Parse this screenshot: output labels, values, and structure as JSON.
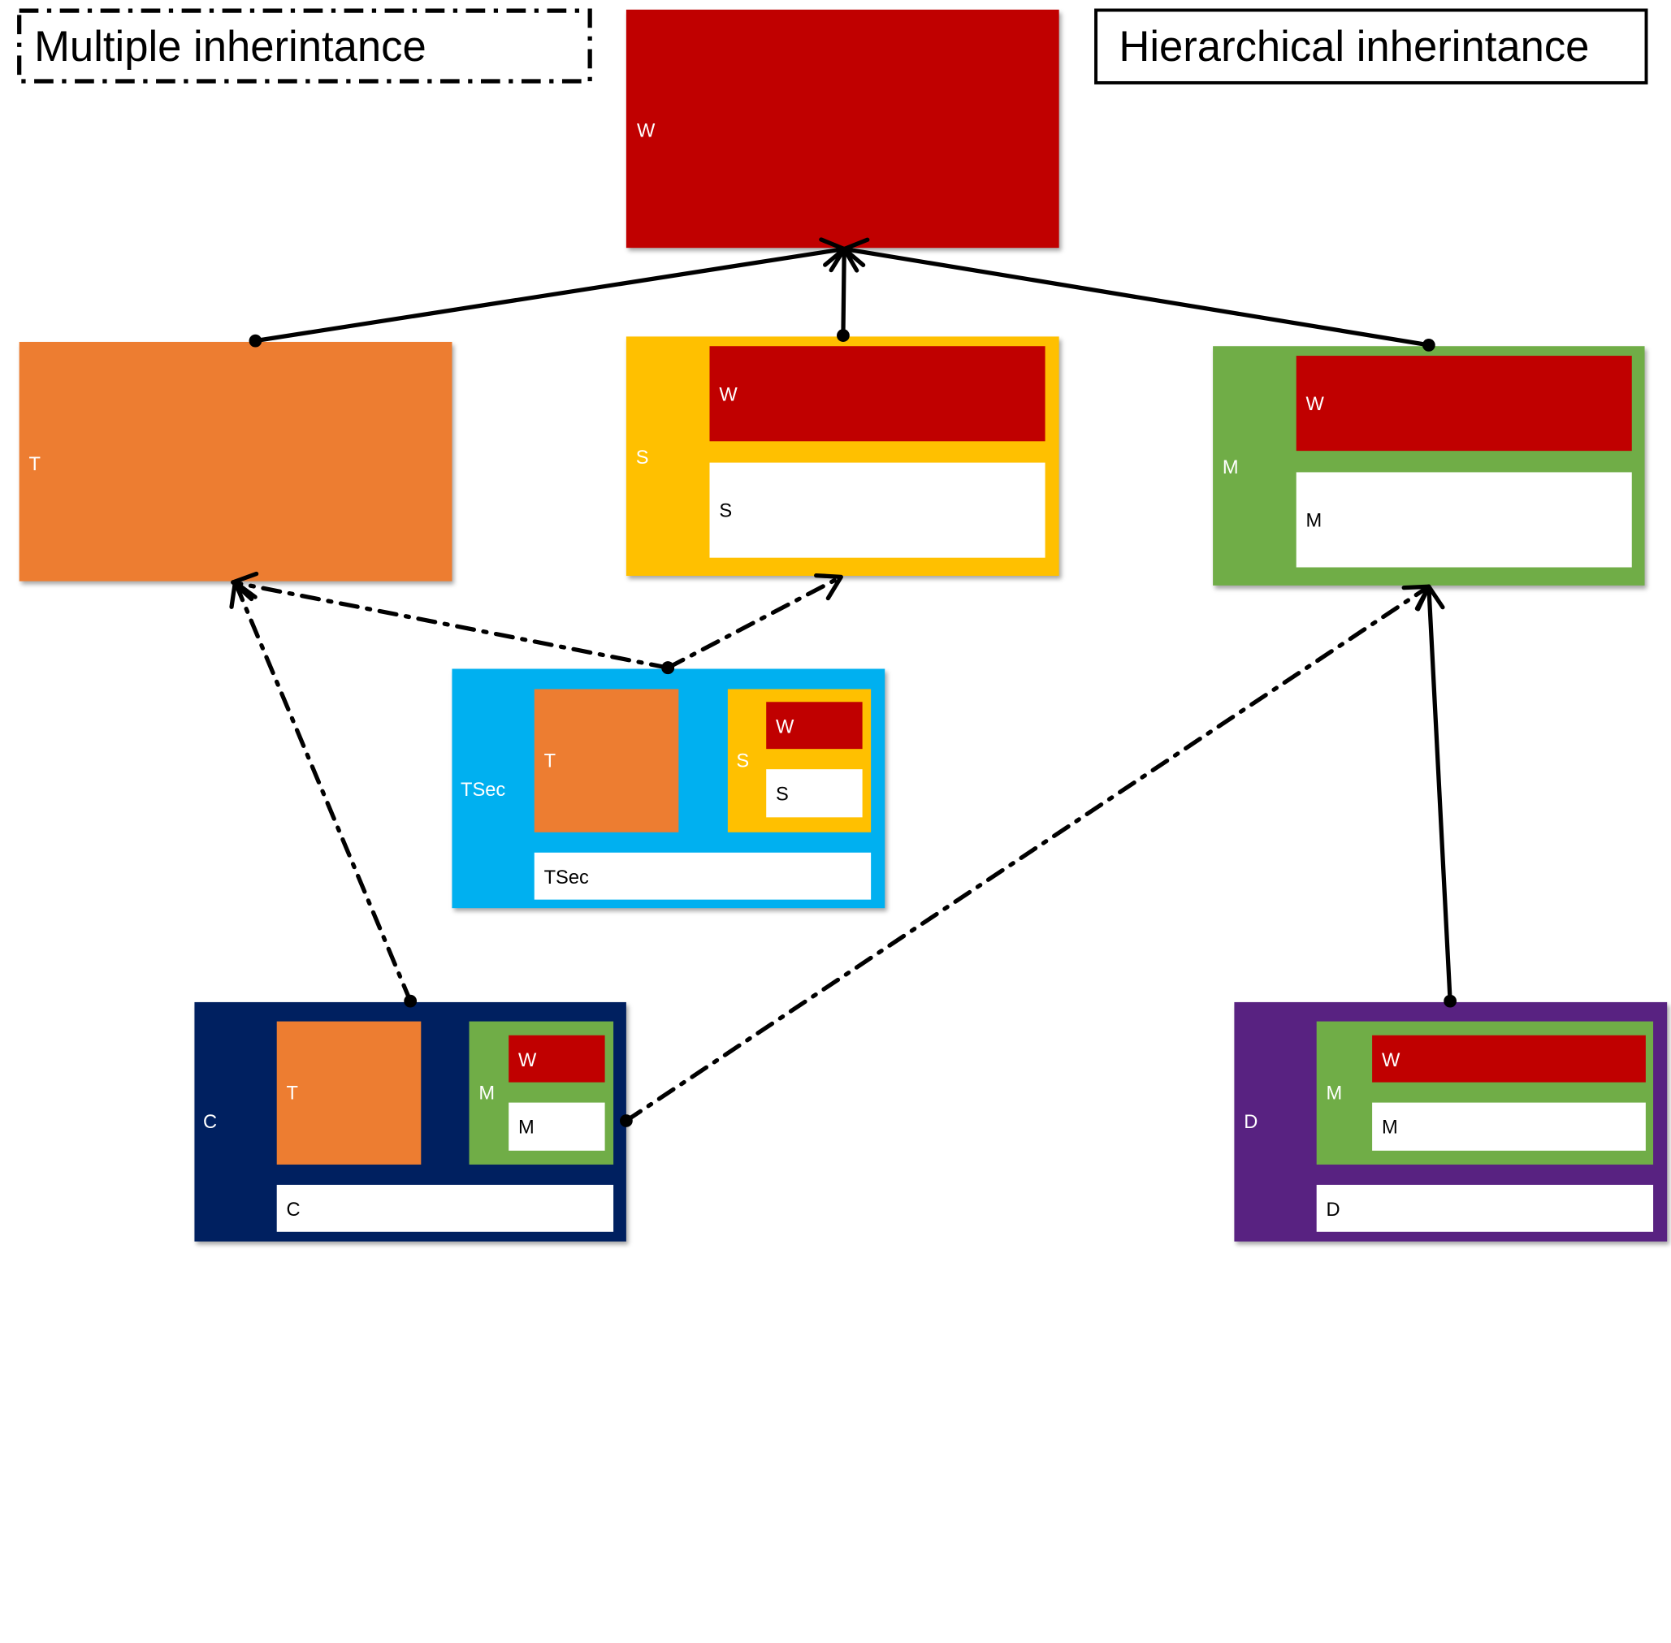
{
  "legend": {
    "multiple": "Multiple inherintance",
    "hierarchical": "Hierarchical inherintance"
  },
  "colors": {
    "W": "#c00000",
    "T": "#ed7d31",
    "S": "#ffc000",
    "M": "#70ad47",
    "TSec": "#00b0f0",
    "C": "#002060",
    "D": "#582281",
    "slot": "#ffffff",
    "line": "#000000"
  },
  "boxes": {
    "W": {
      "label": "W"
    },
    "T": {
      "label": "T"
    },
    "S": {
      "label": "S",
      "inner_w": "W",
      "inner_s": "S"
    },
    "M": {
      "label": "M",
      "inner_w": "W",
      "inner_m": "M"
    },
    "TSec": {
      "label": "TSec",
      "inner_t": "T",
      "inner_s_outer": "S",
      "inner_s_w": "W",
      "inner_s_s": "S",
      "inner_tsec": "TSec"
    },
    "C": {
      "label": "C",
      "inner_t": "T",
      "inner_m_outer": "M",
      "inner_m_w": "W",
      "inner_m_m": "M",
      "inner_c": "C"
    },
    "D": {
      "label": "D",
      "inner_m_outer": "M",
      "inner_m_w": "W",
      "inner_m_m": "M",
      "inner_d": "D"
    }
  },
  "links": [
    {
      "from": "T",
      "to": "W",
      "style": "solid"
    },
    {
      "from": "S",
      "to": "W",
      "style": "solid"
    },
    {
      "from": "M",
      "to": "W",
      "style": "solid"
    },
    {
      "from": "TSec",
      "to": "T",
      "style": "dash-dot"
    },
    {
      "from": "TSec",
      "to": "S",
      "style": "dash-dot"
    },
    {
      "from": "C",
      "to": "T",
      "style": "dash-dot"
    },
    {
      "from": "C",
      "to": "M",
      "style": "dash-dot"
    },
    {
      "from": "D",
      "to": "M",
      "style": "solid"
    }
  ]
}
